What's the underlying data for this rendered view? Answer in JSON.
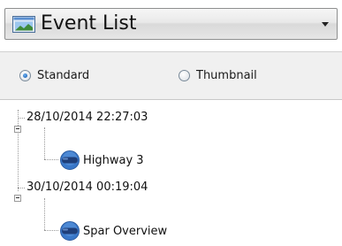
{
  "header": {
    "title": "Event List",
    "icon": "event-list-icon",
    "caret_icon": "chevron-down-icon"
  },
  "view_mode": {
    "options": [
      {
        "label": "Standard",
        "selected": true
      },
      {
        "label": "Thumbnail",
        "selected": false
      }
    ]
  },
  "events": [
    {
      "timestamp": "28/10/2014 22:27:03",
      "expanded": true,
      "children": [
        {
          "label": "Highway 3",
          "icon": "camera-icon"
        }
      ]
    },
    {
      "timestamp": "30/10/2014 00:19:04",
      "expanded": true,
      "children": [
        {
          "label": "Spar Overview",
          "icon": "camera-icon"
        }
      ]
    }
  ],
  "colors": {
    "accent_blue": "#3a78c9",
    "camera_body": "#1f3f7a",
    "tree_line": "#9a9a9a"
  }
}
